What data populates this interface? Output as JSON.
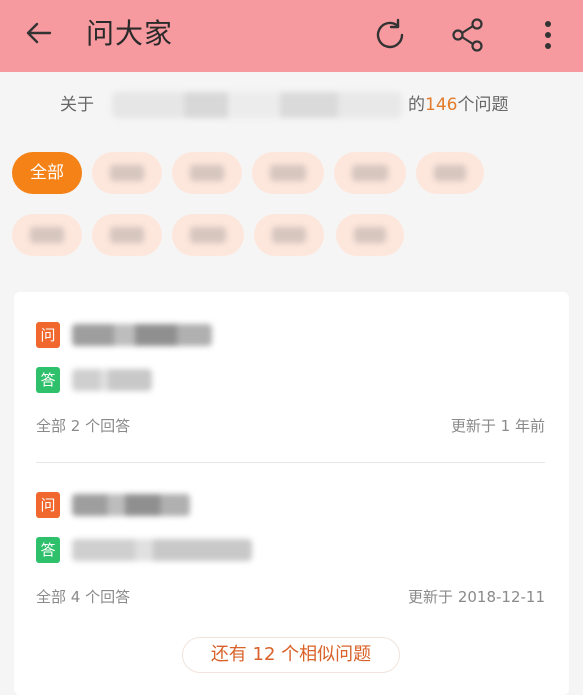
{
  "header": {
    "title": "问大家",
    "icons": {
      "back": "back-arrow-icon",
      "refresh": "refresh-icon",
      "share": "share-icon",
      "more": "more-vertical-icon"
    }
  },
  "about": {
    "prefix": "关于",
    "suffix_before_count": "的",
    "count": "146",
    "suffix_after_count": "个问题"
  },
  "chips": [
    {
      "label": "全部",
      "active": true
    }
  ],
  "questions": [
    {
      "question_badge": "问",
      "answer_badge": "答",
      "answers_meta": "全部 2 个回答",
      "updated": "更新于 1 年前"
    },
    {
      "question_badge": "问",
      "answer_badge": "答",
      "answers_meta": "全部 4 个回答",
      "updated": "更新于 2018-12-11"
    }
  ],
  "more_similar": "还有 12 个相似问题",
  "colors": {
    "topbar": "#f79a9f",
    "accent": "#f58217",
    "question_badge": "#f0682d",
    "answer_badge": "#2ec06a"
  }
}
